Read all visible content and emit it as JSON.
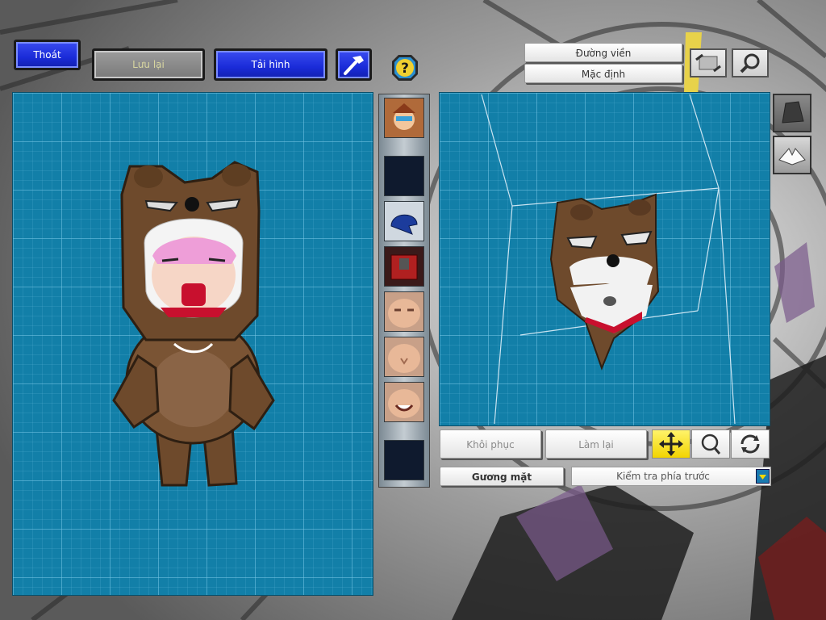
{
  "top_bar": {
    "exit_label": "Thoát",
    "save_label": "Lưu lại",
    "reload_label": "Tải hình"
  },
  "right_top": {
    "outline_label": "Đường viền",
    "default_label": "Mặc định"
  },
  "bottom_controls": {
    "restore_label": "Khôi phục",
    "redo_label": "Làm lại",
    "face_label": "Gương mặt",
    "view_select_value": "Kiểm tra phía trước"
  },
  "colors": {
    "grid_bg": "#127fa8",
    "button_blue": "#1a2bd8",
    "active_tool": "#f2d400",
    "bear_brown": "#6e4a2c"
  },
  "icons": {
    "hammer": "hammer-icon",
    "help": "question-icon",
    "move": "move-arrows-icon",
    "zoom": "magnifier-icon",
    "rotate": "rotate-icon"
  }
}
